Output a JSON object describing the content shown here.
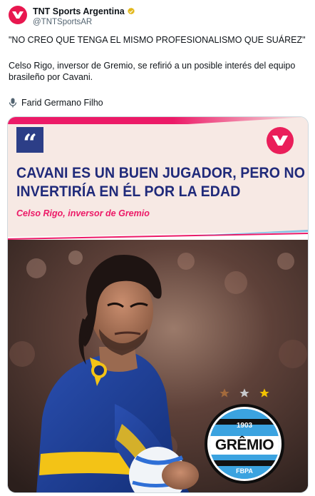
{
  "header": {
    "display_name": "TNT Sports Argentina",
    "handle": "@TNTSportsAR"
  },
  "tweet": {
    "quote_line": "\"NO CREO QUE TENGA EL MISMO PROFESIONALISMO QUE SUÁREZ\"",
    "body": "Celso Rigo, inversor de Gremio, se refirió a un posible interés del equipo brasileño por Cavani.",
    "audio_credit": "Farid Germano Filho"
  },
  "media": {
    "quote_mark": "“",
    "headline_line1": "CAVANI ES UN BUEN JUGADOR, PERO NO",
    "headline_line2": "INVERTIRÍA EN ÉL POR LA EDAD",
    "byline": "Celso Rigo, inversor de Gremio",
    "badge_year": "1903",
    "badge_name": "GRÊMIO",
    "badge_sub": "FBPA"
  },
  "colors": {
    "brand_pink": "#ec1a67",
    "headline_navy": "#202a7a",
    "gremio_blue": "#3ba3e0",
    "boca_blue": "#1b3a8c",
    "boca_yellow": "#f3c316"
  },
  "icons": {
    "avatar": "tnt-logo-icon",
    "verified": "verified-badge-icon",
    "audio": "microphone-icon"
  }
}
